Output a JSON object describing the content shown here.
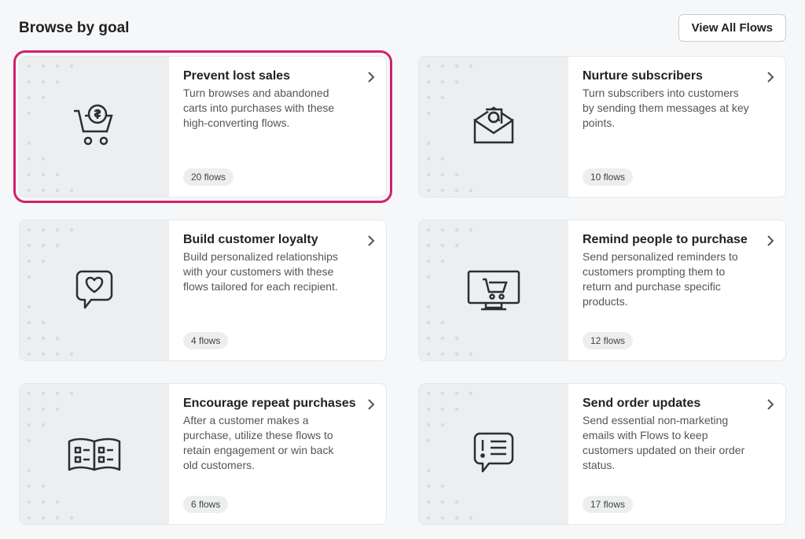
{
  "header": {
    "title": "Browse by goal",
    "view_all_label": "View All Flows"
  },
  "cards": [
    {
      "title": "Prevent lost sales",
      "description": "Turn browses and abandoned carts into purchases with these high-converting flows.",
      "badge": "20 flows",
      "highlight": true
    },
    {
      "title": "Nurture subscribers",
      "description": "Turn subscribers into customers by sending them messages at key points.",
      "badge": "10 flows",
      "highlight": false
    },
    {
      "title": "Build customer loyalty",
      "description": "Build personalized relationships with your customers with these flows tailored for each recipient.",
      "badge": "4 flows",
      "highlight": false
    },
    {
      "title": "Remind people to purchase",
      "description": "Send personalized reminders to customers prompting them to return and purchase specific products.",
      "badge": "12 flows",
      "highlight": false
    },
    {
      "title": "Encourage repeat purchases",
      "description": "After a customer makes a purchase, utilize these flows to retain engagement or win back old customers.",
      "badge": "6 flows",
      "highlight": false
    },
    {
      "title": "Send order updates",
      "description": "Send essential non-marketing emails with Flows to keep customers updated on their order status.",
      "badge": "17 flows",
      "highlight": false
    }
  ]
}
